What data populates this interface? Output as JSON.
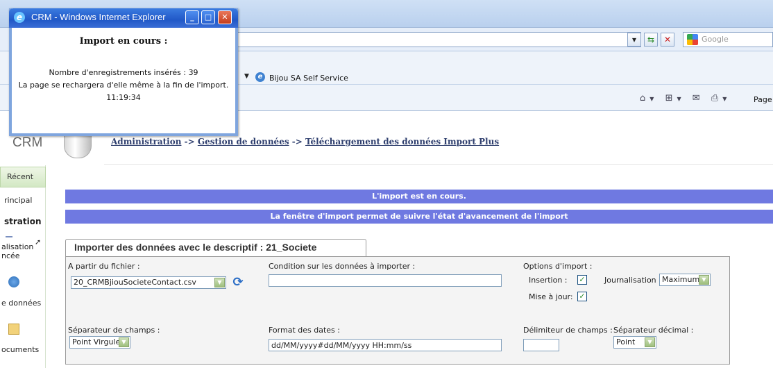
{
  "browser": {
    "title": "CRM - Windows Internet Explorer",
    "search_placeholder": "Google",
    "favorite_link": "Bijou SA Self Service",
    "page_menu": "Page"
  },
  "popup": {
    "window_title": "CRM - Windows Internet Explorer",
    "heading": "Import en cours :",
    "records_line": "Nombre d'enregistrements insérés : 39",
    "reload_line": "La page se rechargera d'elle même à la fin de l'import.",
    "time": "11:19:34"
  },
  "app": {
    "name": "CRM",
    "breadcrumb": {
      "item1": "Administration",
      "sep1": " -> ",
      "item2": "Gestion de données",
      "sep2": " -> ",
      "item3": "Téléchargement des données Import Plus"
    }
  },
  "sidebar": {
    "recent": "Récent",
    "items": [
      "rincipal",
      "stration",
      "alisation",
      "ncée",
      "e données",
      "ocuments"
    ]
  },
  "banners": {
    "status": "L'import est en cours.",
    "info": "La fenêtre d'import permet de suivre l'état d'avancement de l'import"
  },
  "import": {
    "tab_title": "Importer des données avec le descriptif : 21_Societe",
    "file_label": "A partir du fichier :",
    "file_value": "20_CRMBjiouSocieteContact.csv",
    "condition_label": "Condition sur les données à importer :",
    "condition_value": "",
    "options_label": "Options d'import :",
    "insertion_label": "Insertion :",
    "insertion_checked": true,
    "update_label": "Mise à jour:",
    "update_checked": true,
    "journal_label": "Journalisation :",
    "journal_value": "Maximum",
    "field_sep_label": "Séparateur de champs :",
    "field_sep_value": "Point Virgule",
    "date_format_label": "Format des dates :",
    "date_format_value": "dd/MM/yyyy#dd/MM/yyyy HH:mm/ss",
    "delimiter_label": "Délimiteur de champs :",
    "delimiter_value": "",
    "decimal_sep_label": "Séparateur décimal :",
    "decimal_sep_value": "Point"
  }
}
